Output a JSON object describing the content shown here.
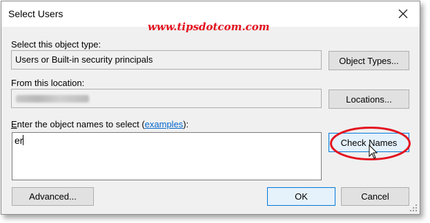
{
  "window": {
    "title": "Select Users",
    "close_icon": "close-icon"
  },
  "watermark": "www.tipsdotcom.com",
  "object_type": {
    "label": "Select this object type:",
    "value": "Users or Built-in security principals",
    "button_label": "Object Types..."
  },
  "location": {
    "label": "From this location:",
    "button_label": "Locations..."
  },
  "names": {
    "label_prefix_underlined": "E",
    "label_middle": "nter the object names to select (",
    "label_link": "examples",
    "label_suffix": "):",
    "value": "er",
    "check_button_label": "Check Names"
  },
  "footer": {
    "advanced_label": "Advanced...",
    "ok_label": "OK",
    "cancel_label": "Cancel"
  },
  "colors": {
    "highlight_ellipse": "#e3121f",
    "focus_border": "#0078d7",
    "link": "#0066cc"
  }
}
